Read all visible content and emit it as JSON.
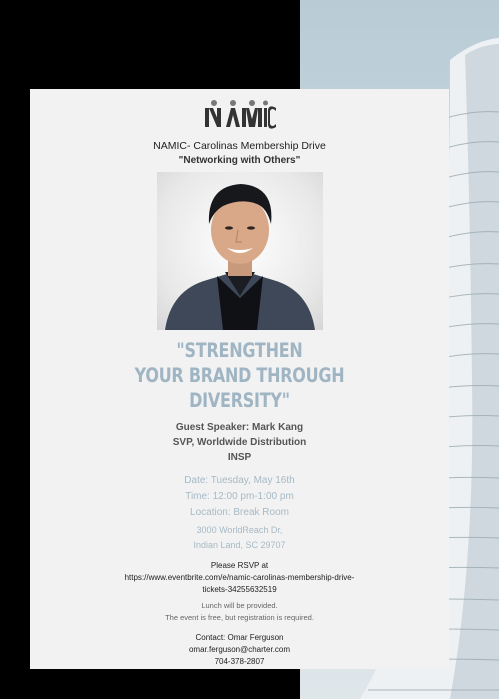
{
  "brand": {
    "logo_text": "NAMIC",
    "accent_color": "#9fb5c3"
  },
  "event": {
    "title": "NAMIC- Carolinas Membership Drive",
    "subtitle": "\"Networking with Others\"",
    "headline": [
      "\"STRENGTHEN",
      "YOUR BRAND THROUGH",
      "DIVERSITY\""
    ]
  },
  "speaker": {
    "line1": "Guest Speaker: Mark Kang",
    "line2": "SVP, Worldwide Distribution",
    "line3": "INSP"
  },
  "details": {
    "date": "Date: Tuesday, May 16th",
    "time": "Time: 12:00 pm-1:00 pm",
    "location": "Location: Break Room",
    "address_line1": "3000 WorldReach Dr,",
    "address_line2": "Indian Land, SC 29707"
  },
  "rsvp": {
    "label": "Please RSVP at",
    "url_line1": "https://www.eventbrite.com/e/namic-carolinas-membership-drive-",
    "url_line2": "tickets-34255632519"
  },
  "notes": {
    "line1": "Lunch will be provided.",
    "line2": "The event is free, but registration is required."
  },
  "contact": {
    "label": "Contact: Omar Ferguson",
    "email": "omar.ferguson@charter.com",
    "phone": "704-378-2807"
  }
}
